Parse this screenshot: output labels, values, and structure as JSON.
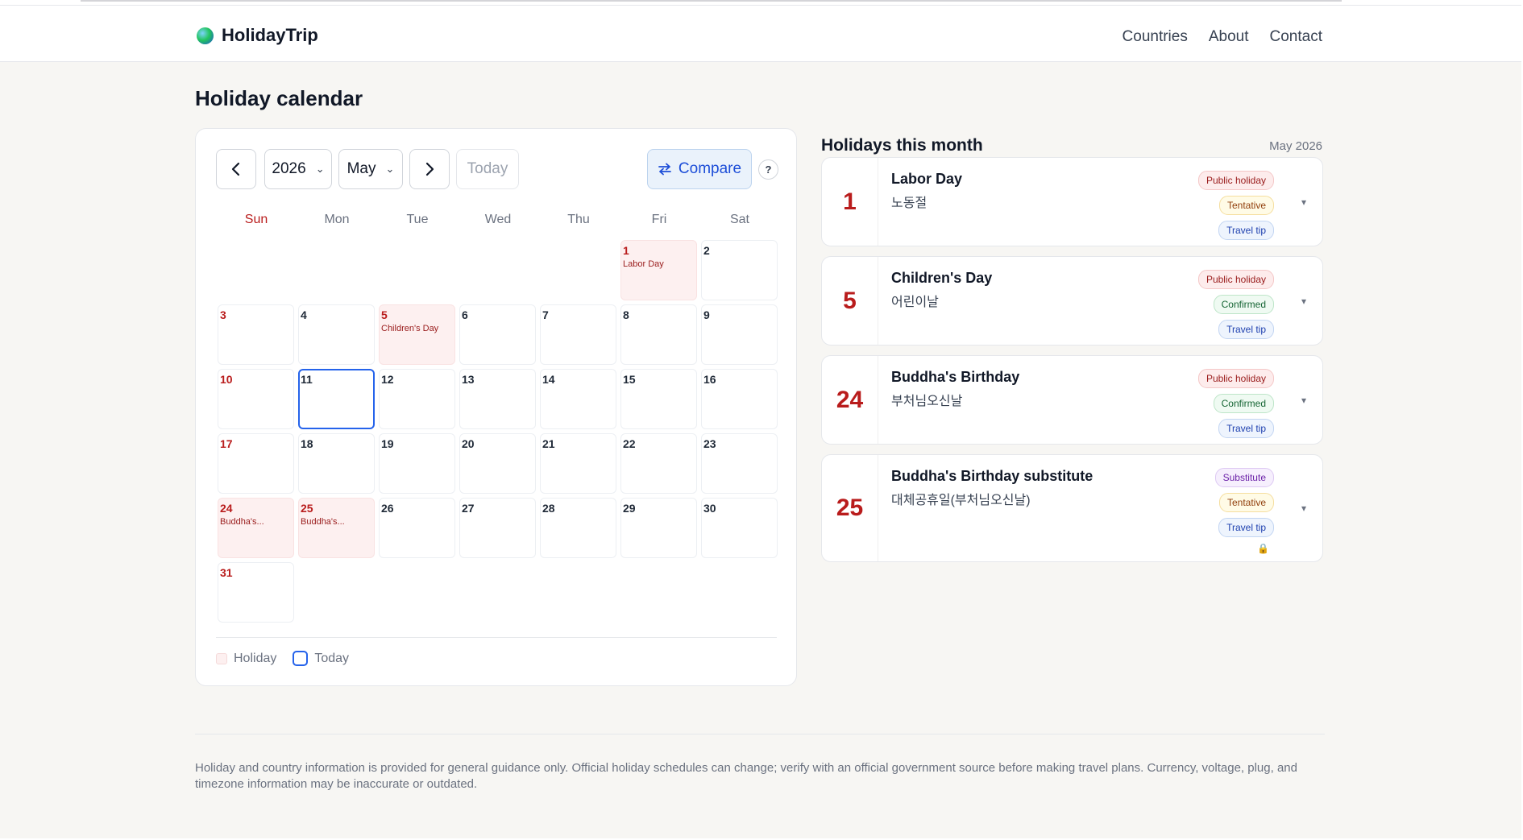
{
  "brand": {
    "name": "HolidayTrip"
  },
  "nav": {
    "items": [
      "Countries",
      "About",
      "Contact"
    ]
  },
  "page_title": "Holiday calendar",
  "calendar": {
    "year": "2026",
    "month": "May",
    "today_label": "Today",
    "compare_label": "Compare",
    "help_label": "?",
    "weekdays": [
      "Sun",
      "Mon",
      "Tue",
      "Wed",
      "Thu",
      "Fri",
      "Sat"
    ],
    "leading_blanks": 5,
    "days_in_month": 31,
    "today": 11,
    "holidays": {
      "1": "Labor Day",
      "5": "Children's Day",
      "24": "Buddha's...",
      "25": "Buddha's..."
    },
    "legend": {
      "holiday": "Holiday",
      "today": "Today"
    }
  },
  "list": {
    "title": "Holidays this month",
    "month": "May 2026",
    "items": [
      {
        "day": "1",
        "name": "Labor Day",
        "local": "노동절",
        "tags": [
          "Public holiday",
          "Tentative",
          "Travel tip"
        ],
        "tag_types": [
          "public",
          "tentative",
          "tip"
        ],
        "lock": false
      },
      {
        "day": "5",
        "name": "Children's Day",
        "local": "어린이날",
        "tags": [
          "Public holiday",
          "Confirmed",
          "Travel tip"
        ],
        "tag_types": [
          "public",
          "confirmed",
          "tip"
        ],
        "lock": false
      },
      {
        "day": "24",
        "name": "Buddha's Birthday",
        "local": "부처님오신날",
        "tags": [
          "Public holiday",
          "Confirmed",
          "Travel tip"
        ],
        "tag_types": [
          "public",
          "confirmed",
          "tip"
        ],
        "lock": false
      },
      {
        "day": "25",
        "name": "Buddha's Birthday substitute",
        "local": "대체공휴일(부처님오신날)",
        "tags": [
          "Substitute",
          "Tentative",
          "Travel tip"
        ],
        "tag_types": [
          "substitute",
          "tentative",
          "tip"
        ],
        "lock": true
      }
    ]
  },
  "footer": {
    "disclaimer": "Holiday and country information is provided for general guidance only. Official holiday schedules can change; verify with an official government source before making travel plans. Currency, voltage, plug, and timezone information may be inaccurate or outdated."
  },
  "icons": {
    "brand": "globe-icon",
    "prev": "chevron-left-icon",
    "next": "chevron-right-icon",
    "compare": "swap-arrows-icon",
    "expand": "caret-down-icon",
    "lock": "lock-icon"
  },
  "colors": {
    "holiday_red": "#b91c1c",
    "accent_blue": "#2563eb",
    "page_bg": "#f7f6f3"
  }
}
